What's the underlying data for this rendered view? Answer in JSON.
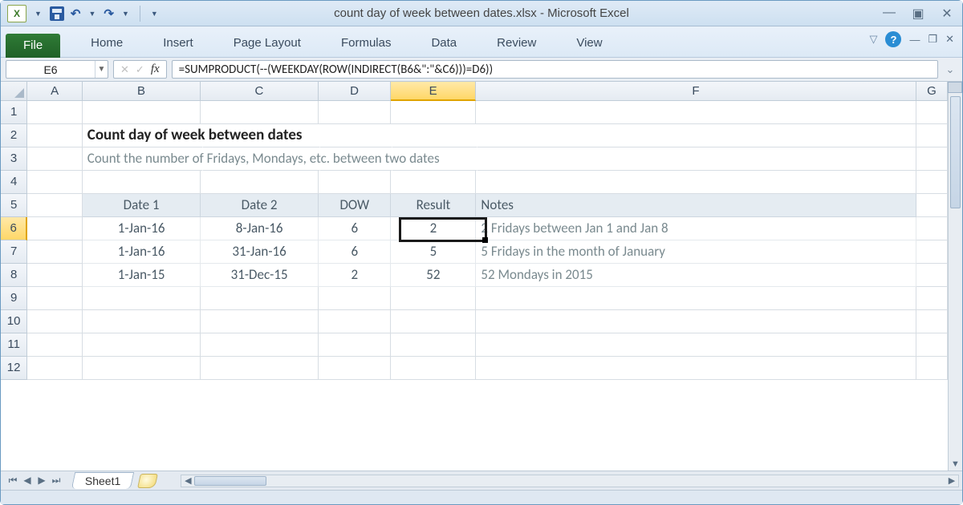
{
  "window": {
    "title": "count day of week between dates.xlsx - Microsoft Excel"
  },
  "ribbon": {
    "file": "File",
    "tabs": [
      "Home",
      "Insert",
      "Page Layout",
      "Formulas",
      "Data",
      "Review",
      "View"
    ]
  },
  "namebox": "E6",
  "formula": "=SUMPRODUCT(--(WEEKDAY(ROW(INDIRECT(B6&\":\"&C6)))=D6))",
  "columns": [
    "A",
    "B",
    "C",
    "D",
    "E",
    "F",
    "G"
  ],
  "row_numbers": [
    "1",
    "2",
    "3",
    "4",
    "5",
    "6",
    "7",
    "8",
    "9",
    "10",
    "11",
    "12"
  ],
  "selected": {
    "col": "E",
    "row": "6"
  },
  "content": {
    "title": "Count day of week between dates",
    "subtitle": "Count the number of Fridays, Mondays, etc. between two dates",
    "headers": {
      "B": "Date 1",
      "C": "Date 2",
      "D": "DOW",
      "E": "Result",
      "F": "Notes"
    },
    "rows": [
      {
        "B": "1-Jan-16",
        "C": "8-Jan-16",
        "D": "6",
        "E": "2",
        "F": "2 Fridays between Jan 1 and Jan 8"
      },
      {
        "B": "1-Jan-16",
        "C": "31-Jan-16",
        "D": "6",
        "E": "5",
        "F": "5 Fridays in the month of January"
      },
      {
        "B": "1-Jan-15",
        "C": "31-Dec-15",
        "D": "2",
        "E": "52",
        "F": "52 Mondays in 2015"
      }
    ]
  },
  "sheet": {
    "active": "Sheet1"
  }
}
